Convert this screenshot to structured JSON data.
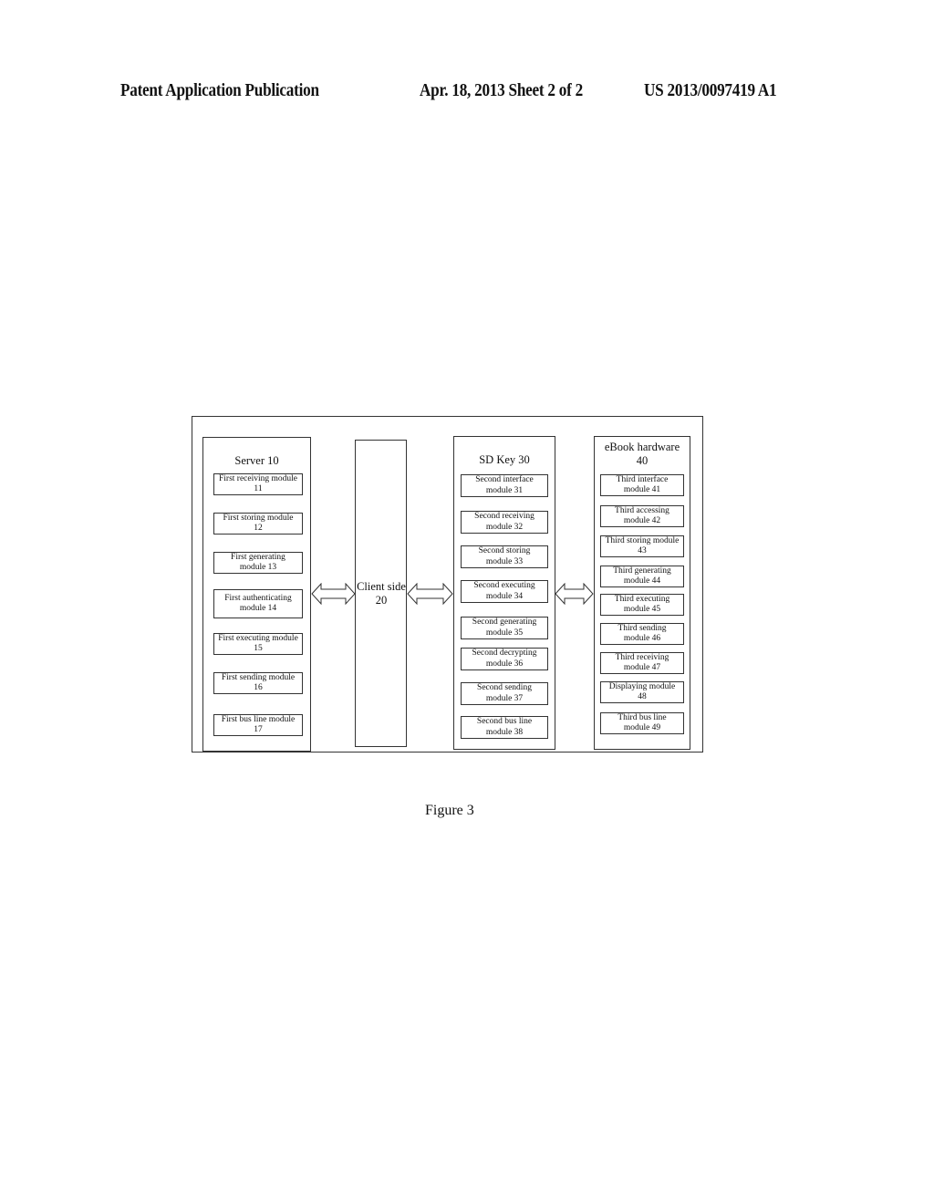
{
  "header": {
    "publication": "Patent Application Publication",
    "date_sheet": "Apr. 18, 2013  Sheet 2 of 2",
    "number": "US 2013/0097419 A1"
  },
  "diagram": {
    "server": {
      "title": "Server 10",
      "modules": [
        {
          "line1": "First receiving module",
          "line2": "11"
        },
        {
          "line1": "First storing module",
          "line2": "12"
        },
        {
          "line1": "First generating",
          "line2": "module 13"
        },
        {
          "line1": "First authenticating",
          "line2": "module 14"
        },
        {
          "line1": "First executing module",
          "line2": "15"
        },
        {
          "line1": "First sending module",
          "line2": "16"
        },
        {
          "line1": "First bus line module",
          "line2": "17"
        }
      ]
    },
    "client": {
      "line1": "Client side",
      "line2": "20"
    },
    "sdkey": {
      "title": "SD Key 30",
      "modules": [
        {
          "line1": "Second interface",
          "line2": "module 31"
        },
        {
          "line1": "Second receiving",
          "line2": "module 32"
        },
        {
          "line1": "Second storing",
          "line2": "module 33"
        },
        {
          "line1": "Second executing",
          "line2": "module 34"
        },
        {
          "line1": "Second generating",
          "line2": "module 35"
        },
        {
          "line1": "Second decrypting",
          "line2": "module 36"
        },
        {
          "line1": "Second sending",
          "line2": "module 37"
        },
        {
          "line1": "Second bus line",
          "line2": "module 38"
        }
      ]
    },
    "ebook": {
      "title_line1": "eBook hardware",
      "title_line2": "40",
      "modules": [
        {
          "line1": "Third interface",
          "line2": "module 41"
        },
        {
          "line1": "Third accessing",
          "line2": "module 42"
        },
        {
          "line1": "Third storing module",
          "line2": "43"
        },
        {
          "line1": "Third generating",
          "line2": "module 44"
        },
        {
          "line1": "Third executing",
          "line2": "module 45"
        },
        {
          "line1": "Third sending",
          "line2": "module 46"
        },
        {
          "line1": "Third receiving",
          "line2": "module 47"
        },
        {
          "line1": "Displaying module",
          "line2": "48"
        },
        {
          "line1": "Third bus line",
          "line2": "module 49"
        }
      ]
    },
    "connections": [
      {
        "from": "Server 10",
        "to": "Client side 20",
        "type": "bidirectional"
      },
      {
        "from": "Client side 20",
        "to": "SD Key 30",
        "type": "bidirectional"
      },
      {
        "from": "SD Key 30",
        "to": "eBook hardware 40",
        "type": "bidirectional"
      }
    ]
  },
  "caption": "Figure 3"
}
